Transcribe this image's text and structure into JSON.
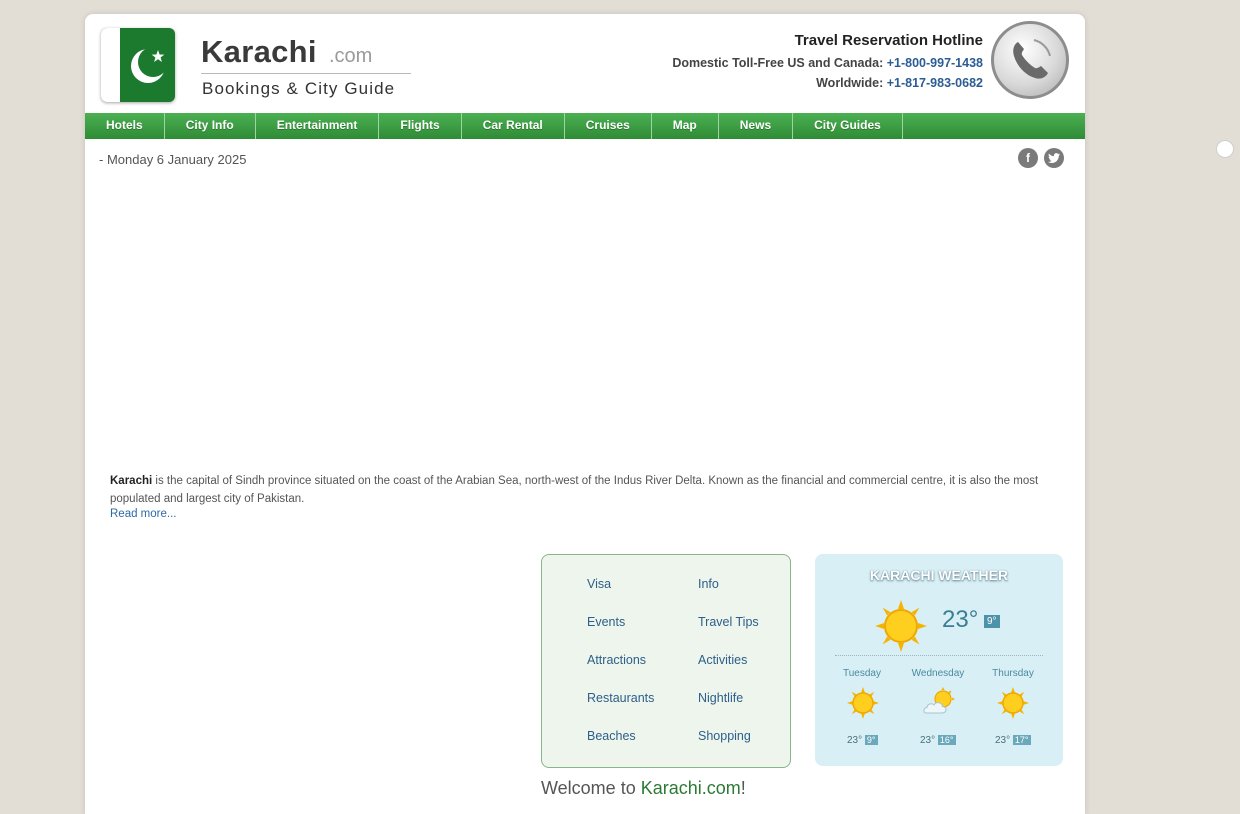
{
  "brand": {
    "name": "Karachi",
    "suffix": ".com",
    "tagline": "Bookings & City Guide"
  },
  "hotline": {
    "title": "Travel Reservation Hotline",
    "domestic_label": "Domestic Toll-Free US and Canada:",
    "domestic_number": "+1-800-997-1438",
    "worldwide_label": "Worldwide:",
    "worldwide_number": "+1-817-983-0682"
  },
  "nav": {
    "items": [
      "Hotels",
      "City Info",
      "Entertainment",
      "Flights",
      "Car Rental",
      "Cruises",
      "Map",
      "News",
      "City Guides"
    ]
  },
  "date": "- Monday 6 January 2025",
  "social": {
    "facebook_icon": "facebook-icon",
    "twitter_icon": "twitter-icon"
  },
  "intro": {
    "city": "Karachi",
    "text": " is the capital of Sindh province situated on the coast of the Arabian Sea, north-west of the Indus River Delta. Known as the financial and commercial centre, it is also the most populated and largest city of Pakistan.",
    "read_more": "Read more..."
  },
  "links": {
    "left": [
      "Visa",
      "Events",
      "Attractions",
      "Restaurants",
      "Beaches"
    ],
    "right": [
      "Info",
      "Travel Tips",
      "Activities",
      "Nightlife",
      "Shopping"
    ]
  },
  "weather": {
    "title": "KARACHI WEATHER",
    "current_temp": "23°",
    "current_low": "9°",
    "days": [
      {
        "name": "Tuesday",
        "icon": "sun-icon",
        "high": "23°",
        "low": "9°"
      },
      {
        "name": "Wednesday",
        "icon": "partly-cloudy-icon",
        "high": "23°",
        "low": "16°"
      },
      {
        "name": "Thursday",
        "icon": "sun-icon",
        "high": "23°",
        "low": "17°"
      }
    ]
  },
  "welcome": {
    "prefix": "Welcome to ",
    "site": "Karachi.com",
    "suffix": "!"
  },
  "colors": {
    "nav_green": "#2e8c35",
    "link_blue": "#2c5f8a",
    "weather_bg": "#d8eff5"
  }
}
